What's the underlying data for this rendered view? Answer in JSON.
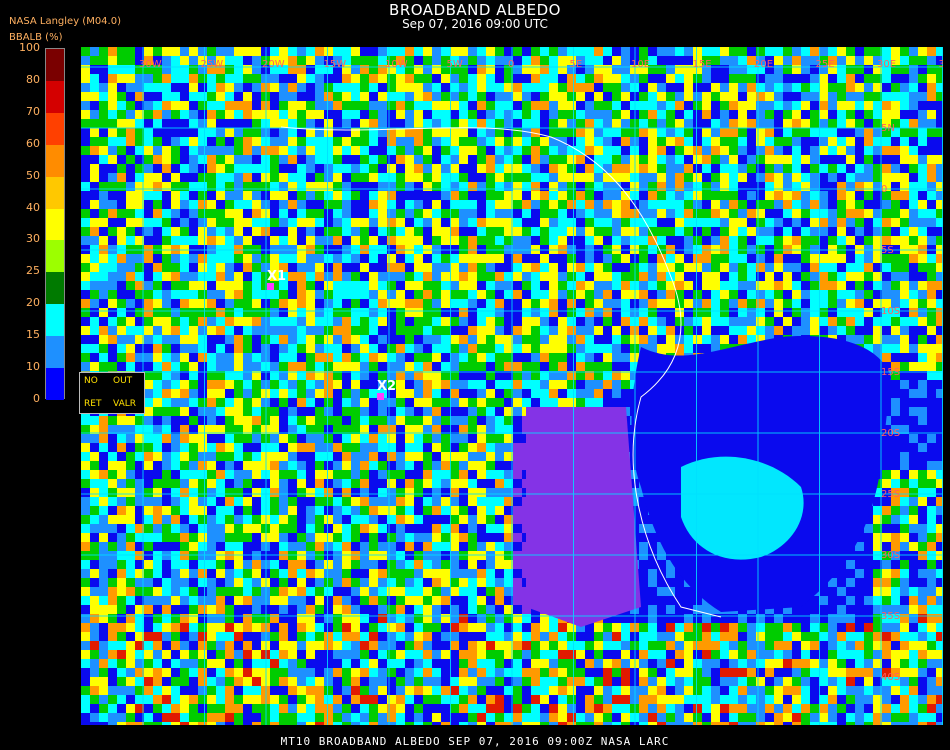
{
  "header": {
    "title": "BROADBAND ALBEDO",
    "subtitle": "Sep 07, 2016 09:00 UTC",
    "source": "NASA Langley (M04.0)",
    "units": "BBALB (%)"
  },
  "colorbar": {
    "ticks": [
      "100",
      "80",
      "70",
      "60",
      "50",
      "40",
      "30",
      "25",
      "20",
      "15",
      "10",
      "0"
    ],
    "colors": [
      "#7a0000",
      "#d40000",
      "#ff4000",
      "#ff8c00",
      "#ffc800",
      "#ffff00",
      "#9cff00",
      "#007a00",
      "#00ffff",
      "#1e90ff",
      "#0000ff",
      "#8a2be2"
    ]
  },
  "map": {
    "palette": {
      "purple": "#8433e6",
      "blue": "#0a0aee",
      "lightblue": "#1e90ff",
      "cyan": "#00ffff",
      "green": "#00cc00",
      "yellow": "#ffff00",
      "orange": "#ff9a00",
      "red": "#e11a00",
      "grid": "#00e0ff"
    },
    "lon_labels": [
      "30W",
      "25W",
      "20W",
      "15W",
      "10W",
      "5W",
      "0",
      "5E",
      "10E",
      "15E",
      "20E",
      "25E",
      "30E",
      "35E"
    ],
    "lat_labels": [
      "5N",
      "0",
      "5S",
      "10S",
      "15S",
      "20S",
      "25S",
      "30S",
      "35S",
      "40S"
    ],
    "markers": [
      {
        "label": "X1"
      },
      {
        "label": "X2"
      }
    ]
  },
  "legend_box": {
    "no": "NO",
    "out": "OUT",
    "ret": "RET",
    "valr": "VALR"
  },
  "footer": "MT10  BROADBAND ALBEDO  SEP 07, 2016 09:00Z  NASA LARC"
}
